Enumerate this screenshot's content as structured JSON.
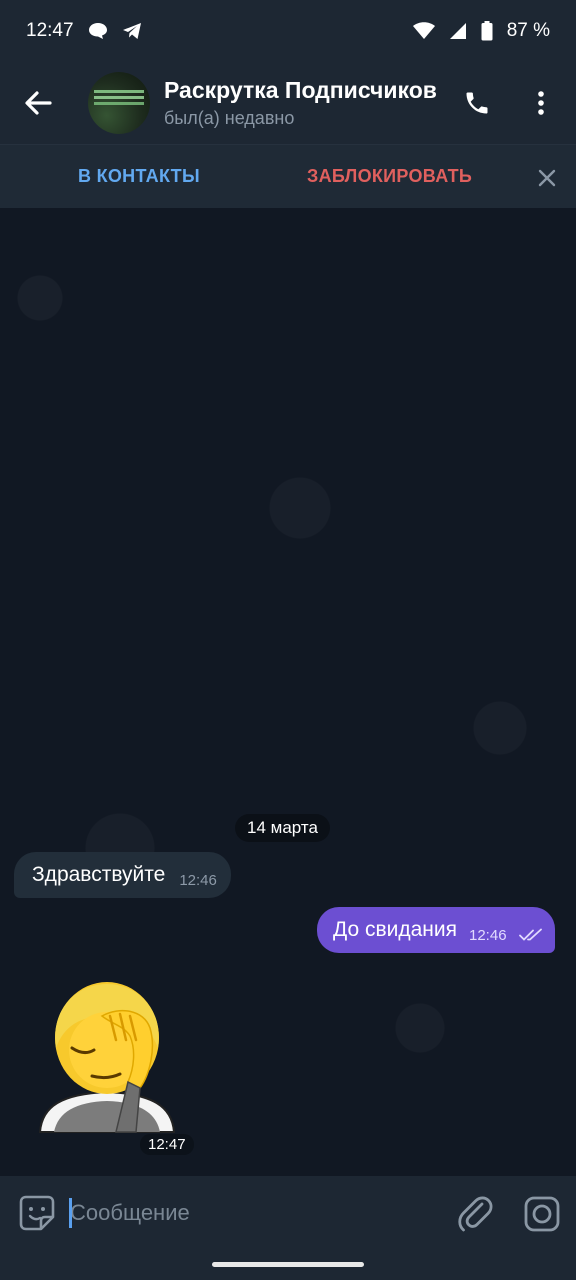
{
  "status_bar": {
    "time": "12:47",
    "battery": "87 %",
    "icons": [
      "chat-bubble-icon",
      "telegram-icon",
      "wifi-icon",
      "signal-icon",
      "battery-icon"
    ]
  },
  "header": {
    "title": "Раскрутка Подписчиков",
    "subtitle": "был(а) недавно"
  },
  "action_bar": {
    "add_contact": "В КОНТАКТЫ",
    "block": "ЗАБЛОКИРОВАТЬ"
  },
  "chat": {
    "date": "14 марта",
    "messages": [
      {
        "direction": "incoming",
        "text": "Здравствуйте",
        "time": "12:46"
      },
      {
        "direction": "outgoing",
        "text": "До свидания",
        "time": "12:46",
        "status": "read"
      },
      {
        "direction": "incoming",
        "type": "sticker",
        "sticker": "facepalm",
        "time": "12:47"
      }
    ]
  },
  "composer": {
    "placeholder": "Сообщение"
  },
  "colors": {
    "background": "#111823",
    "bar": "#1d2733",
    "accent_blue": "#62a9f0",
    "danger_red": "#e0605e",
    "outgoing_bubble": "#6c4fd2",
    "incoming_bubble": "#222e3a"
  }
}
